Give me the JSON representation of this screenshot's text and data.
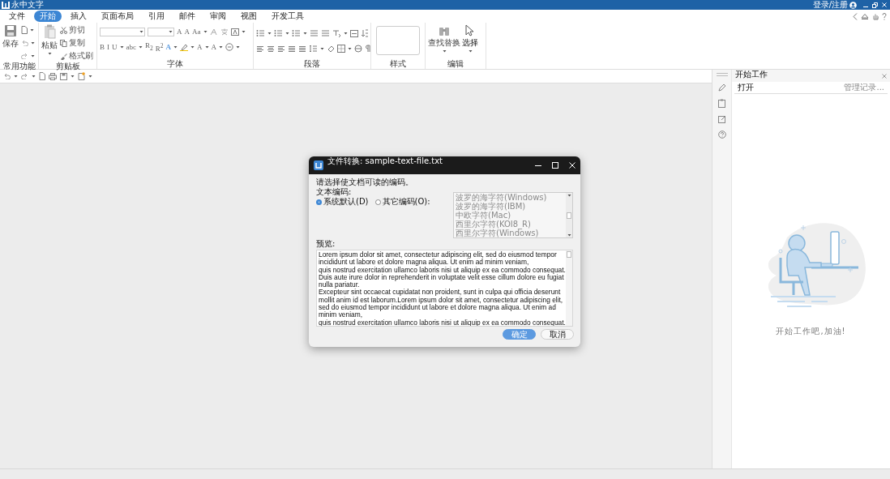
{
  "app": {
    "title": "永中文字",
    "account": "登录/注册"
  },
  "menu": [
    {
      "label": "文件",
      "selected": false
    },
    {
      "label": "开始",
      "selected": true
    },
    {
      "label": "插入",
      "selected": false
    },
    {
      "label": "页面布局",
      "selected": false
    },
    {
      "label": "引用",
      "selected": false
    },
    {
      "label": "邮件",
      "selected": false
    },
    {
      "label": "审阅",
      "selected": false
    },
    {
      "label": "视图",
      "selected": false
    },
    {
      "label": "开发工具",
      "selected": false
    }
  ],
  "ribbon": {
    "save": "保存",
    "paste": "粘贴",
    "cut": "剪切",
    "copy": "复制",
    "format_painter": "格式刷",
    "font_row1": [
      "A",
      "A",
      "Aa"
    ],
    "font_row2": [
      "B",
      "I",
      "U",
      "abc",
      "R$_{2}$",
      "R$^{2}$",
      "A",
      "A",
      "A"
    ],
    "find_replace": "查找替换",
    "select": "选择",
    "groups": [
      "常用功能",
      "剪贴板",
      "字体",
      "段落",
      "样式",
      "编辑"
    ]
  },
  "dialog": {
    "title": "文件转换: sample-text-file.txt",
    "prompt": "请选择使文档可读的编码。",
    "encoding_label": "文本编码:",
    "options": [
      {
        "label": "系统默认(D)",
        "selected": true
      },
      {
        "label": "其它编码(O):",
        "selected": false
      }
    ],
    "encodings": [
      "波罗的海字符(Windows)",
      "波罗的海字符(IBM)",
      "中欧字符(Mac)",
      "西里尔字符(KOI8_R)",
      "西里尔字符(Windows)"
    ],
    "preview_label": "预览:",
    "preview_lines": [
      "Lorem ipsum dolor sit amet, consectetur adipiscing elit, sed do eiusmod tempor",
      "incididunt ut labore et dolore magna aliqua. Ut enim ad minim veniam,",
      "quis nostrud exercitation ullamco laboris nisi ut aliquip ex ea commodo consequat.",
      "Duis aute irure dolor in reprehenderit in voluptate velit esse cillum dolore eu fugiat",
      "nulla pariatur.",
      "Excepteur sint occaecat cupidatat non proident, sunt in culpa qui officia deserunt",
      "mollit anim id est laborum.Lorem ipsum dolor sit amet, consectetur adipiscing elit,",
      "sed do eiusmod tempor incididunt ut labore et dolore magna aliqua. Ut enim ad",
      "minim veniam,",
      "quis nostrud exercitation ullamco laboris nisi ut aliquip ex ea commodo consequat."
    ],
    "ok": "确定",
    "cancel": "取消"
  },
  "panel": {
    "title": "开始工作",
    "open": "打开",
    "manage": "管理记录...",
    "caption": "开始工作吧,加油!"
  }
}
